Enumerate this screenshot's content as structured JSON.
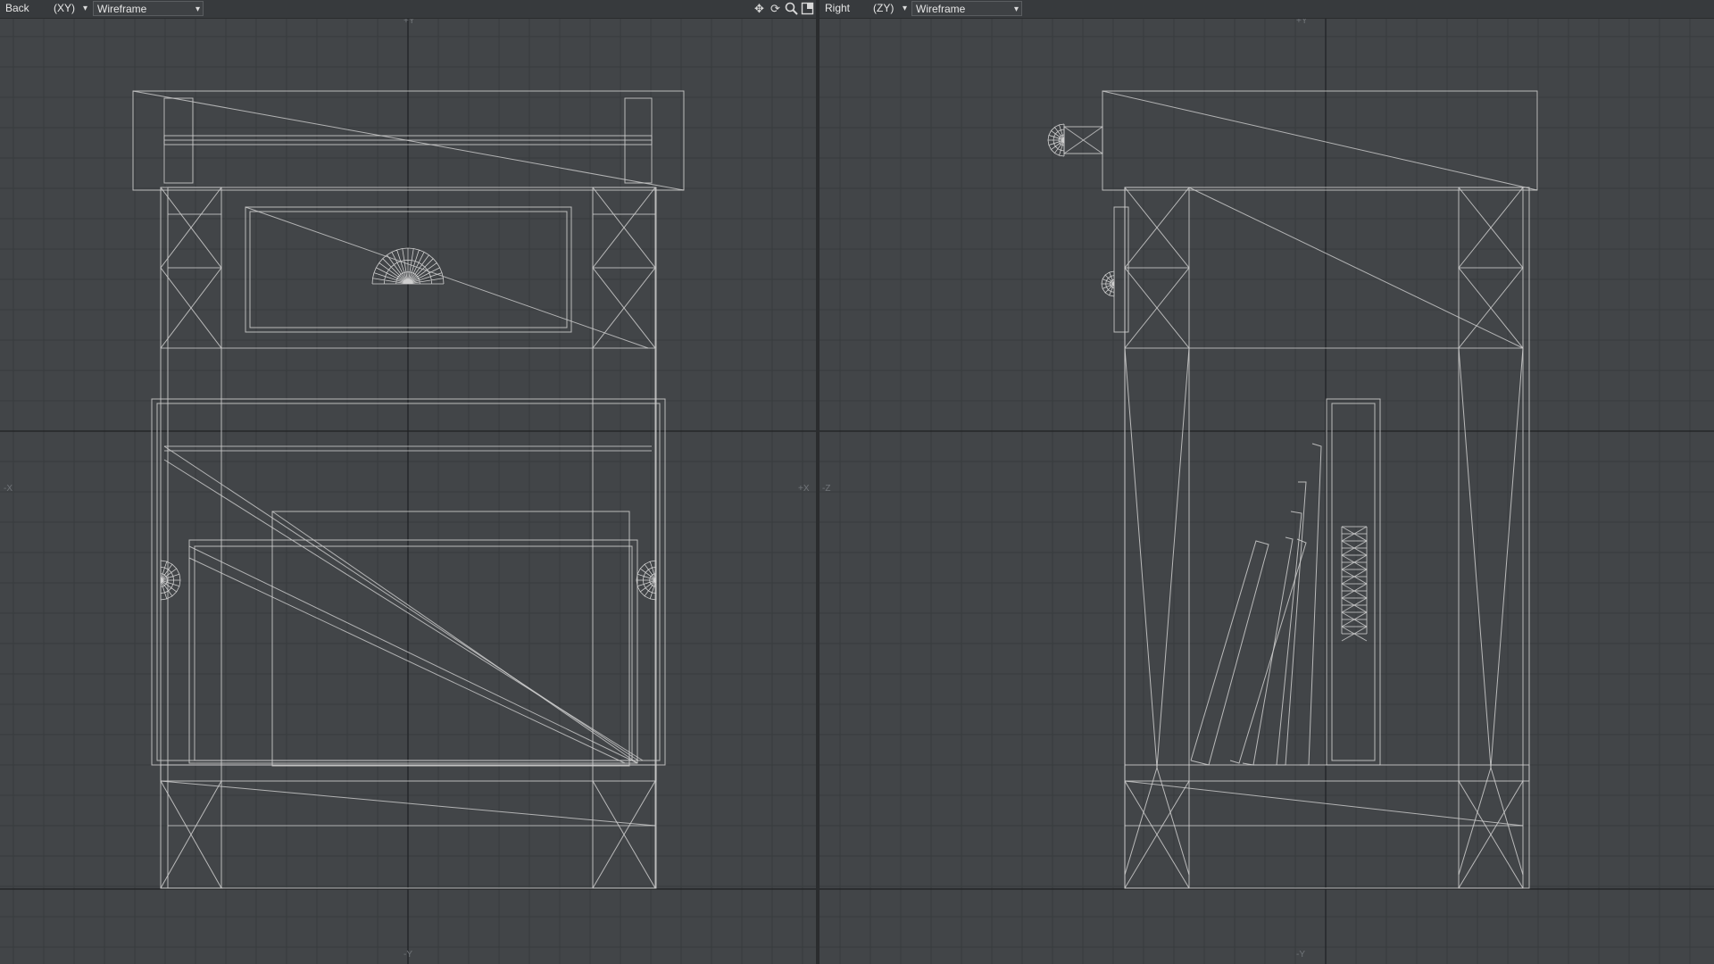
{
  "left_viewport": {
    "view_name": "Back",
    "axes": "(XY)",
    "render_mode": "Wireframe",
    "axis_top": "+Y",
    "axis_bottom": "-Y",
    "axis_left": "-X",
    "axis_right": "+X",
    "tool_icons": [
      "move-icon",
      "rotate-icon",
      "zoom-icon",
      "maximize-icon"
    ]
  },
  "right_viewport": {
    "view_name": "Right",
    "axes": "(ZY)",
    "render_mode": "Wireframe",
    "axis_top": "+Y",
    "axis_bottom": "-Y",
    "axis_left": "-Z"
  },
  "colors": {
    "viewport_bg": "#424548",
    "grid_line": "#383b3e",
    "major_axis": "#1f2123",
    "wire": "#cfcfcf",
    "toolbar_bg": "#373a3d"
  },
  "icons": {
    "dropdown": "chevron-down-icon",
    "move": "move-icon",
    "rotate": "rotate-icon",
    "zoom": "zoom-icon",
    "maximize": "maximize-icon"
  }
}
